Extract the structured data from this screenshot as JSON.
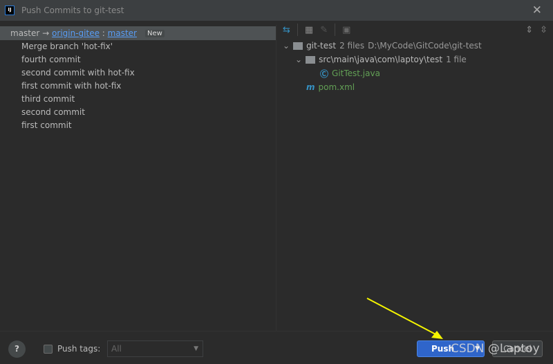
{
  "window": {
    "title": "Push Commits to git-test",
    "close_icon": "close-icon"
  },
  "branch": {
    "local": "master",
    "arrow": "→",
    "remote": "origin-gitee",
    "sep": ":",
    "remote_branch": "master",
    "badge": "New"
  },
  "commits": [
    "Merge branch 'hot-fix'",
    "fourth commit",
    "second commit with hot-fix",
    "first commit with hot-fix",
    "third commit",
    "second commit",
    "first commit"
  ],
  "tree": {
    "root": {
      "name": "git-test",
      "count": "2 files",
      "path": "D:\\MyCode\\GitCode\\git-test"
    },
    "folder": {
      "name": "src\\main\\java\\com\\laptoy\\test",
      "count": "1 file"
    },
    "files": [
      "GitTest.java",
      "pom.xml"
    ]
  },
  "footer": {
    "help": "?",
    "push_tags_label": "Push tags:",
    "push_tags_checked": false,
    "tags_select": "All",
    "push_label": "Push",
    "cancel_label": "Cancel"
  },
  "watermark": "CSDN @Laptoy",
  "colors": {
    "accent": "#2f65ca",
    "link": "#589df6",
    "file_modified": "#62a055"
  }
}
